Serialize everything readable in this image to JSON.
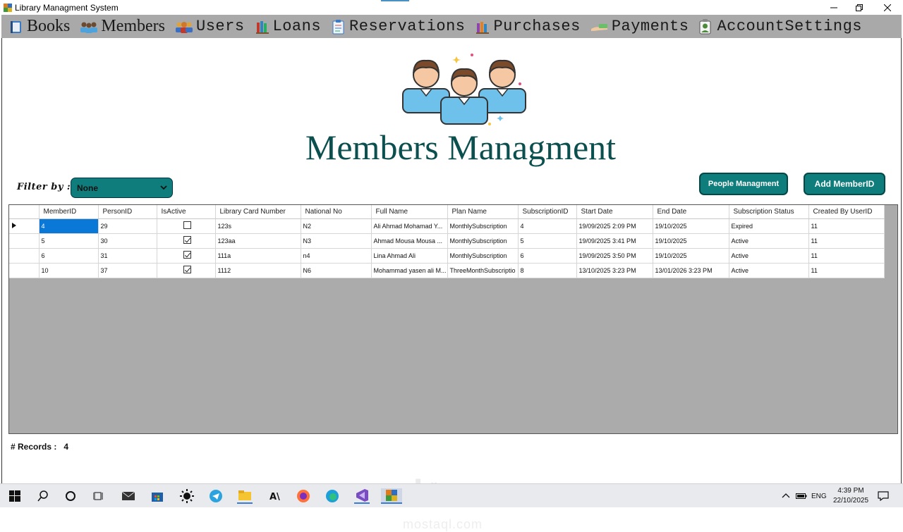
{
  "window": {
    "title": "Library Managment System"
  },
  "menu": [
    {
      "label": "Books",
      "icon": "book-icon"
    },
    {
      "label": "Members",
      "icon": "members-icon"
    },
    {
      "label": "Users",
      "icon": "users-icon"
    },
    {
      "label": "Loans",
      "icon": "loans-icon"
    },
    {
      "label": "Reservations",
      "icon": "reservations-icon"
    },
    {
      "label": "Purchases",
      "icon": "purchases-icon"
    },
    {
      "label": "Payments",
      "icon": "payments-icon"
    },
    {
      "label": "AccountSettings",
      "icon": "account-settings-icon"
    }
  ],
  "page": {
    "title": "Members Managment"
  },
  "filter": {
    "label": "Filter by :",
    "value": "None"
  },
  "buttons": {
    "people": "People Managment",
    "add": "Add MemberID"
  },
  "table": {
    "columns": [
      "MemberID",
      "PersonID",
      "IsActive",
      "Library Card Number",
      "National No",
      "Full Name",
      "Plan Name",
      "SubscriptionID",
      "Start Date",
      "End Date",
      "Subscription Status",
      "Created By UserID"
    ],
    "rows": [
      {
        "MemberID": "4",
        "PersonID": "29",
        "IsActive": false,
        "LibraryCardNumber": "123s",
        "NationalNo": "N2",
        "FullName": "Ali Ahmad Mohamad Y...",
        "PlanName": "MonthlySubscription",
        "SubscriptionID": "4",
        "StartDate": "19/09/2025 2:09 PM",
        "EndDate": "19/10/2025",
        "SubscriptionStatus": "Expired",
        "CreatedByUserID": "11"
      },
      {
        "MemberID": "5",
        "PersonID": "30",
        "IsActive": true,
        "LibraryCardNumber": "123aa",
        "NationalNo": "N3",
        "FullName": "Ahmad Mousa Mousa ...",
        "PlanName": "MonthlySubscription",
        "SubscriptionID": "5",
        "StartDate": "19/09/2025 3:41 PM",
        "EndDate": "19/10/2025",
        "SubscriptionStatus": "Active",
        "CreatedByUserID": "11"
      },
      {
        "MemberID": "6",
        "PersonID": "31",
        "IsActive": true,
        "LibraryCardNumber": "111a",
        "NationalNo": "n4",
        "FullName": "Lina Ahmad  Ali",
        "PlanName": "MonthlySubscription",
        "SubscriptionID": "6",
        "StartDate": "19/09/2025 3:50 PM",
        "EndDate": "19/10/2025",
        "SubscriptionStatus": "Active",
        "CreatedByUserID": "11"
      },
      {
        "MemberID": "10",
        "PersonID": "37",
        "IsActive": true,
        "LibraryCardNumber": "1112",
        "NationalNo": "N6",
        "FullName": "Mohammad yasen ali M...",
        "PlanName": "ThreeMonthSubscriptio",
        "SubscriptionID": "8",
        "StartDate": "13/10/2025 3:23 PM",
        "EndDate": "13/01/2026 3:23 PM",
        "SubscriptionStatus": "Active",
        "CreatedByUserID": "11"
      }
    ]
  },
  "records": {
    "label": "# Records :",
    "count": "4"
  },
  "watermark": {
    "arabic": "مستقل",
    "latin": "mostaql.com"
  },
  "taskbar": {
    "language": "ENG",
    "time": "4:39 PM",
    "date": "22/10/2025"
  },
  "colors": {
    "teal": "#0e7d7b",
    "title_teal": "#0b4f4f",
    "menu_bg": "#a9a9a9",
    "grid_bg": "#ababab",
    "selection": "#0a78d7"
  }
}
